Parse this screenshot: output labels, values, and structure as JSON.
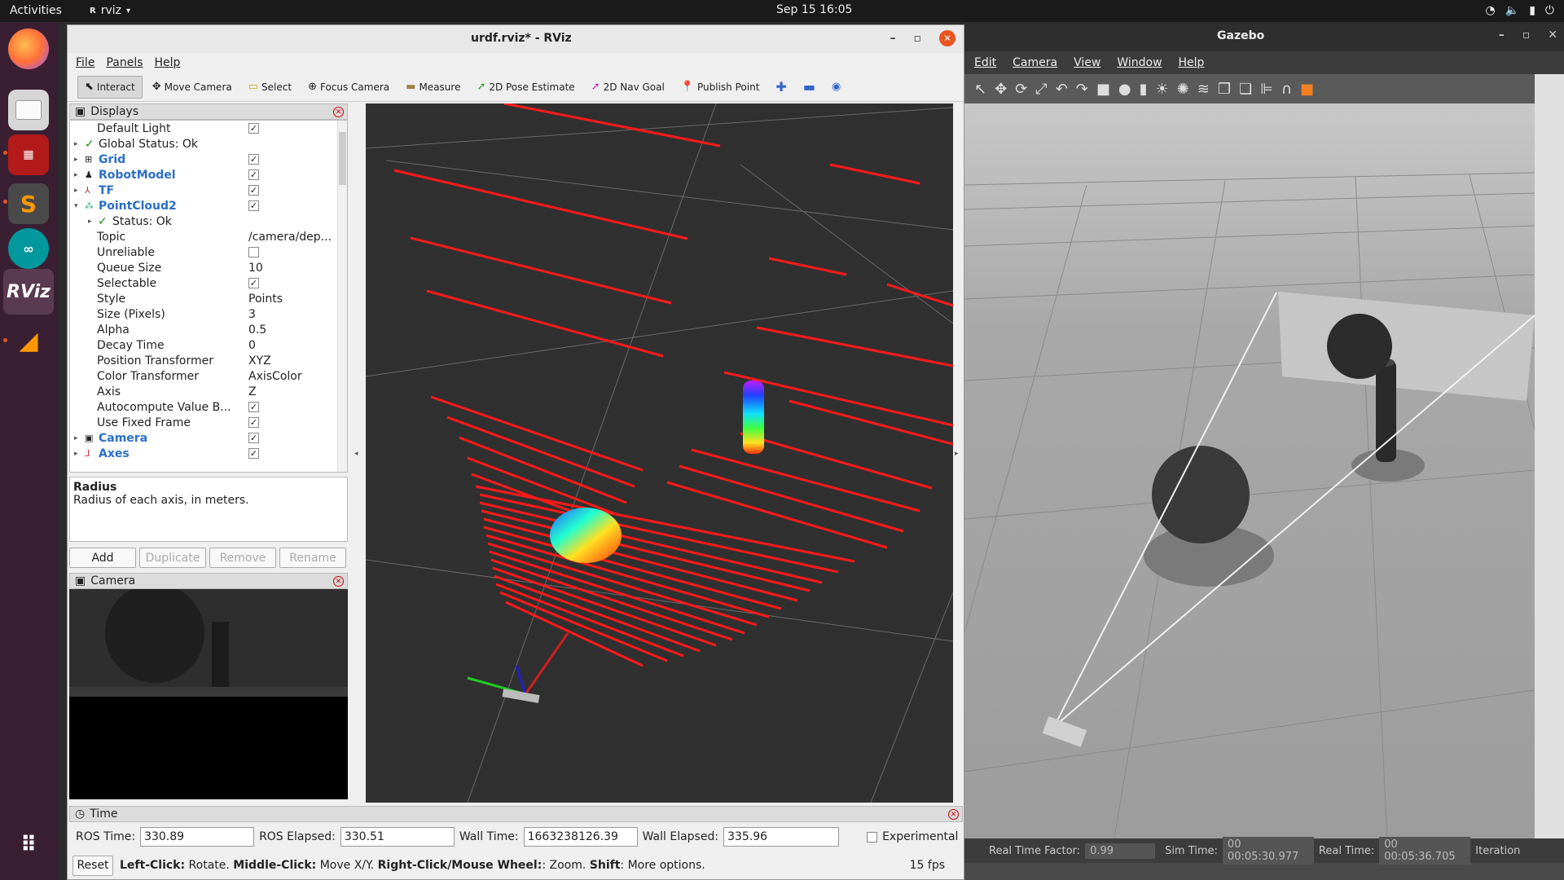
{
  "topbar": {
    "activities": "Activities",
    "app_name": "rviz",
    "clock": "Sep 15  16:05"
  },
  "dock": {
    "items": [
      "firefox-icon",
      "files-icon",
      "terminal-icon",
      "sublime-icon",
      "arduino-icon",
      "rviz-icon",
      "sublime-merge-icon",
      "apps-grid-icon"
    ],
    "rviz_label": "RViz"
  },
  "rviz": {
    "title": "urdf.rviz* - RViz",
    "menu": [
      "File",
      "Panels",
      "Help"
    ],
    "tools": [
      "Interact",
      "Move Camera",
      "Select",
      "Focus Camera",
      "Measure",
      "2D Pose Estimate",
      "2D Nav Goal",
      "Publish Point"
    ],
    "displays": {
      "title": "Displays",
      "rows": [
        {
          "label": "Default Light",
          "check": true
        },
        {
          "label": "Global Status: Ok"
        },
        {
          "label": "Grid",
          "check": true
        },
        {
          "label": "RobotModel",
          "check": true
        },
        {
          "label": "TF",
          "check": true
        },
        {
          "label": "PointCloud2",
          "check": true
        },
        {
          "label": "Status: Ok"
        },
        {
          "label": "Topic",
          "value": "/camera/dep..."
        },
        {
          "label": "Unreliable",
          "check": false
        },
        {
          "label": "Queue Size",
          "value": "10"
        },
        {
          "label": "Selectable",
          "check": true
        },
        {
          "label": "Style",
          "value": "Points"
        },
        {
          "label": "Size (Pixels)",
          "value": "3"
        },
        {
          "label": "Alpha",
          "value": "0.5"
        },
        {
          "label": "Decay Time",
          "value": "0"
        },
        {
          "label": "Position Transformer",
          "value": "XYZ"
        },
        {
          "label": "Color Transformer",
          "value": "AxisColor"
        },
        {
          "label": "Axis",
          "value": "Z"
        },
        {
          "label": "Autocompute Value B...",
          "check": true
        },
        {
          "label": "Use Fixed Frame",
          "check": true
        },
        {
          "label": "Camera",
          "check": true
        },
        {
          "label": "Axes",
          "check": true
        }
      ],
      "desc_title": "Radius",
      "desc_text": "Radius of each axis, in meters.",
      "buttons": [
        "Add",
        "Duplicate",
        "Remove",
        "Rename"
      ]
    },
    "camera_panel": {
      "title": "Camera"
    },
    "time": {
      "title": "Time",
      "ros_time_label": "ROS Time:",
      "ros_time": "330.89",
      "ros_elapsed_label": "ROS Elapsed:",
      "ros_elapsed": "330.51",
      "wall_time_label": "Wall Time:",
      "wall_time": "1663238126.39",
      "wall_elapsed_label": "Wall Elapsed:",
      "wall_elapsed": "335.96",
      "experimental": "Experimental"
    },
    "status": {
      "reset": "Reset",
      "left_click": "Left-Click:",
      "left_click_text": "Rotate.",
      "middle_click": "Middle-Click:",
      "middle_click_text": "Move X/Y.",
      "right_click": "Right-Click/Mouse Wheel:",
      "right_click_text": ": Zoom.",
      "shift": "Shift",
      "shift_text": ": More options.",
      "fps": "15 fps"
    }
  },
  "gazebo": {
    "title": "Gazebo",
    "menu": [
      "Edit",
      "Camera",
      "View",
      "Window",
      "Help"
    ],
    "status": {
      "rtf_label": "Real Time Factor:",
      "rtf": "0.99",
      "sim_label": "Sim Time:",
      "sim": "00 00:05:30.977",
      "real_label": "Real Time:",
      "real": "00 00:05:36.705",
      "iter_label": "Iteration"
    }
  }
}
